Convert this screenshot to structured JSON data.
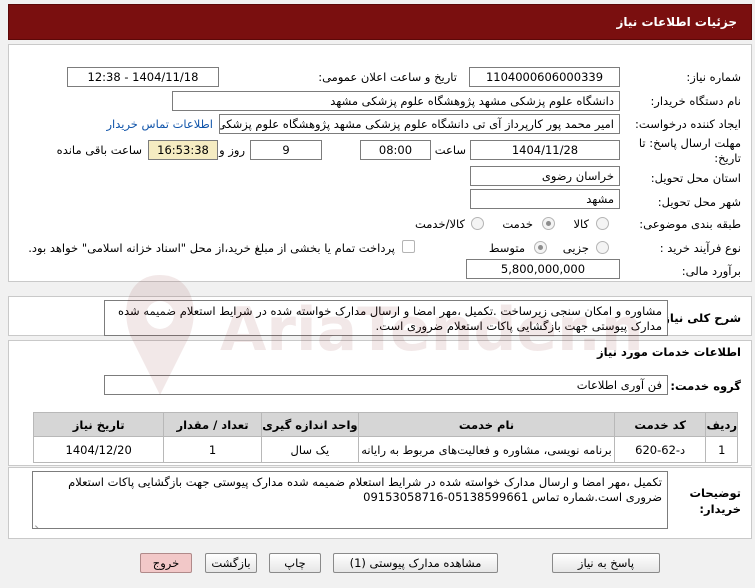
{
  "header": {
    "title": "جزئیات اطلاعات نیاز"
  },
  "need_number": {
    "label": "شماره نیاز:",
    "value": "1104000606000339"
  },
  "announce": {
    "label": "تاریخ و ساعت اعلان عمومی:",
    "value": "1404/11/18 - 12:38"
  },
  "buyer_org": {
    "label": "نام دستگاه خریدار:",
    "value": "دانشگاه علوم پزشکی مشهد   پژوهشگاه علوم پزشکی مشهد"
  },
  "requester": {
    "label": "ایجاد کننده درخواست:",
    "value": "امیر محمد پور کارپرداز آی تی دانشگاه علوم پزشکی مشهد   پژوهشگاه علوم پزشکی مشهد",
    "contact_link": "اطلاعات تماس خریدار"
  },
  "deadline": {
    "label_line1": "مهلت ارسال پاسخ: تا",
    "label_line2": "تاریخ:",
    "date": "1404/11/28",
    "time_label": "ساعت",
    "time": "08:00",
    "days": "9",
    "days_label": "روز و",
    "remaining": "16:53:38",
    "remaining_label": "ساعت باقی مانده"
  },
  "province": {
    "label": "استان محل تحویل:",
    "value": "خراسان رضوی"
  },
  "city": {
    "label": "شهر محل تحویل:",
    "value": "مشهد"
  },
  "category": {
    "label": "طبقه بندی موضوعی:",
    "options": [
      "کالا",
      "خدمت",
      "کالا/خدمت"
    ],
    "selected": "خدمت"
  },
  "process": {
    "label": "نوع فرآیند خرید :",
    "options": [
      "جزیی",
      "متوسط"
    ],
    "selected": "متوسط",
    "checkbox_text": "پرداخت تمام یا بخشی از مبلغ خرید،از محل \"اسناد خزانه اسلامی\" خواهد بود."
  },
  "budget": {
    "label": "برآورد مالی:",
    "value": "5,800,000,000"
  },
  "summary": {
    "label": "شرح کلی نیاز:",
    "text": "مشاوره و امکان سنجی زیرساخت .تکمیل ،مهر امضا و ارسال مدارک خواسته شده در شرایط استعلام ضمیمه شده مدارک پیوستی جهت بازگشایی پاکات استعلام ضروری است."
  },
  "services": {
    "section_title": "اطلاعات خدمات مورد نیاز",
    "group_label": "گروه خدمت:",
    "group_value": "فن آوری اطلاعات",
    "columns": [
      "ردیف",
      "کد خدمت",
      "نام خدمت",
      "واحد اندازه گیری",
      "تعداد / مقدار",
      "تاریخ نیاز"
    ],
    "rows": [
      [
        "1",
        "د-62-620",
        "برنامه نویسی، مشاوره و فعالیت‌های مربوط به رایانه",
        "یک سال",
        "1",
        "1404/12/20"
      ]
    ]
  },
  "buyer_notes": {
    "label_line1": "توضیحات",
    "label_line2": "خریدار:",
    "text": "تکمیل ،مهر امضا و ارسال مدارک خواسته شده در شرایط استعلام ضمیمه شده مدارک پیوستی جهت بازگشایی پاکات استعلام ضروری است.شماره تماس 05138599661-09153058716"
  },
  "buttons": {
    "reply": "پاسخ به نیاز",
    "attachments": "مشاهده مدارک پیوستی (1)",
    "print": "چاپ",
    "back": "بازگشت",
    "exit": "خروج"
  },
  "watermark": {
    "text": "AriaTender.net"
  },
  "colors": {
    "header": "#7a0f0f",
    "remaining_bg": "#f5ecc2",
    "link": "#1155aa",
    "exit_button": "#f2c8c8"
  }
}
